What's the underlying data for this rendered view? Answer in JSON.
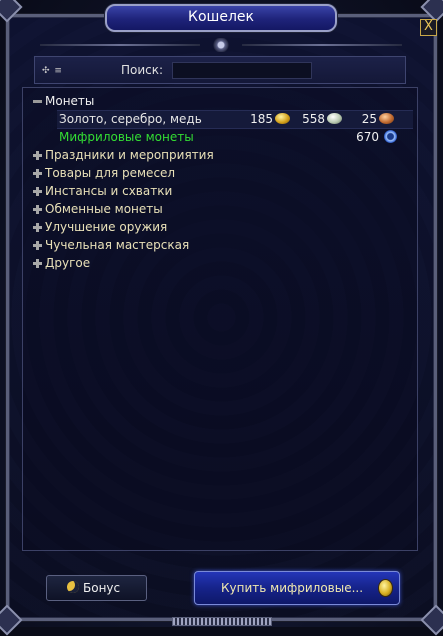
{
  "window": {
    "title": "Кошелек",
    "close_label": "X"
  },
  "search": {
    "label": "Поиск:",
    "value": "",
    "placeholder": ""
  },
  "currency_tree": {
    "expanded_category": {
      "label": "Монеты",
      "items": [
        {
          "label": "Золото, серебро, медь",
          "gold": "185",
          "silver": "558",
          "copper": "25"
        },
        {
          "label": "Мифриловые монеты",
          "amount": "670",
          "label_color": "#33dd33"
        }
      ]
    },
    "collapsed_categories": [
      "Праздники и мероприятия",
      "Товары для ремесел",
      "Инстансы и схватки",
      "Обменные монеты",
      "Улучшение оружия",
      "Чучельная мастерская",
      "Другое"
    ]
  },
  "footer": {
    "bonus_label": "Бонус",
    "buy_label": "Купить мифриловые..."
  },
  "colors": {
    "title_bar": "#1e237a",
    "category_text": "#e8e0b8",
    "mithril_text": "#33dd33",
    "buy_button": "#16238a"
  },
  "icons": [
    "close-icon",
    "sort-icon",
    "minus-icon",
    "plus-icon",
    "gold-coin-icon",
    "silver-coin-icon",
    "copper-coin-icon",
    "mithril-coin-icon",
    "moon-icon",
    "gold-coin-icon"
  ]
}
